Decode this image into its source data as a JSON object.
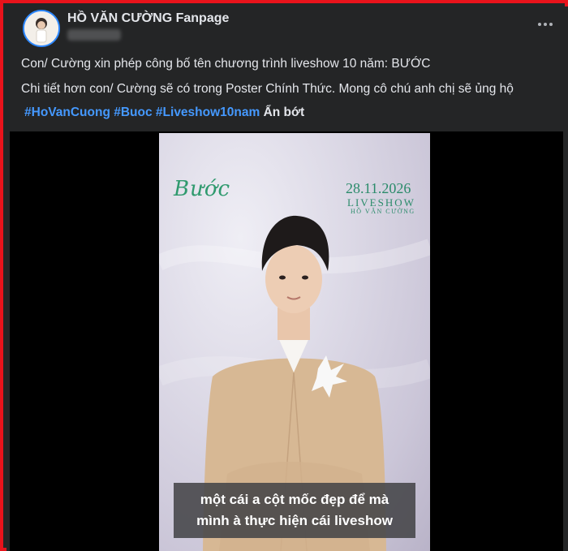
{
  "post": {
    "page_name": "HỒ VĂN CƯỜNG Fanpage",
    "caption_line1": "Con/ Cường xin phép công bố tên chương trình liveshow 10 năm: BƯỚC",
    "caption_line2": "Chi tiết hơn con/ Cường sẽ có trong Poster Chính Thức. Mong cô chú anh chị sẽ ủng hộ",
    "hashtags": [
      "#HoVanCuong",
      "#Buoc",
      "#Liveshow10nam"
    ],
    "see_less": "Ẩn bớt"
  },
  "video": {
    "title_script": "Bước",
    "date": "28.11.2026",
    "liveshow": "LIVESHOW",
    "artist": "HỒ VĂN CƯỜNG",
    "subtitle_line1": "một cái a cột mốc đẹp để mà",
    "subtitle_line2": "mình à thực hiện cái liveshow"
  },
  "colors": {
    "frame_border": "#e8131b",
    "background": "#242526",
    "hashtag": "#4599ff",
    "text": "#e4e6eb",
    "poster_green": "#2a8b6a"
  }
}
